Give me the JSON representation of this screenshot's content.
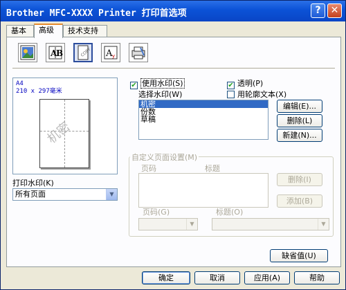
{
  "window": {
    "title": "Brother MFC-XXXX Printer 打印首选项",
    "help_btn": "?",
    "close_btn": "✕"
  },
  "tabs": [
    "基本",
    "高级",
    "技术支持"
  ],
  "toolbar": {
    "icons": [
      "color-icon",
      "scaling-icon",
      "watermark-icon",
      "print-text-icon",
      "device-options-icon"
    ],
    "active_index": 2
  },
  "preview": {
    "paper": "A4",
    "size": "210 x 297毫米",
    "watermark_text": "机密"
  },
  "print_watermark": {
    "label": "打印水印(K)",
    "value": "所有页面"
  },
  "use_watermark": {
    "label": "使用水印(S)",
    "checked": true
  },
  "transparent": {
    "label": "透明(P)",
    "checked": true
  },
  "outline_text": {
    "label": "用轮廓文本(X)",
    "checked": false
  },
  "select_watermark": {
    "label": "选择水印(W)",
    "items": [
      "机密",
      "份数",
      "草稿"
    ],
    "selected": 0
  },
  "watermark_buttons": {
    "edit": "编辑(E)...",
    "delete": "删除(L)",
    "new": "新建(N)..."
  },
  "custom_page": {
    "title": "自定义页面设置(M)",
    "col_page": "页码",
    "col_title": "标题",
    "delete": "删除(I)",
    "add": "添加(B)",
    "page_label": "页码(G)",
    "title_label": "标题(O)"
  },
  "default_button": "缺省值(U)",
  "footer": {
    "ok": "确定",
    "cancel": "取消",
    "apply": "应用(A)",
    "help": "帮助"
  },
  "colors": {
    "titlebar": "#0b52d6",
    "selection": "#316ac5",
    "tab_accent": "#e68b2c"
  }
}
